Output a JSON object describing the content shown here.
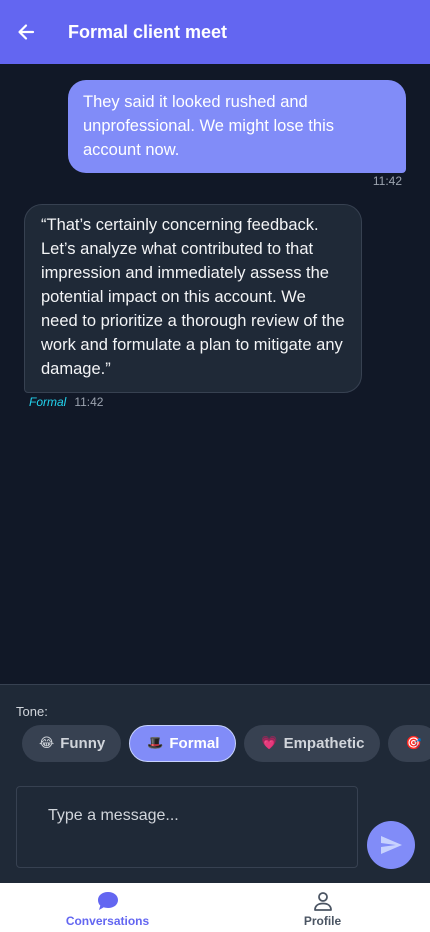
{
  "header": {
    "title": "Formal client meet",
    "back_icon": "arrow-left-icon"
  },
  "messages": {
    "outgoing": {
      "text": "They said it looked rushed and unprofessional. We might lose this account now.",
      "time": "11:42"
    },
    "incoming": {
      "text": "“That’s certainly concerning feedback. Let’s analyze what contributed to that impression and immediately assess the potential impact on this account. We need to prioritize a thorough review of the work and formulate a plan to mitigate any damage.”",
      "tone": "Formal",
      "time": "11:42"
    }
  },
  "composer": {
    "tone_label": "Tone:",
    "tones": [
      {
        "emoji": "😂",
        "label": "Funny",
        "active": false
      },
      {
        "emoji": "🎩",
        "label": "Formal",
        "active": true
      },
      {
        "emoji": "💗",
        "label": "Empathetic",
        "active": false
      },
      {
        "emoji": "🎯",
        "label": "",
        "active": false
      }
    ],
    "input_placeholder": "Type a message...",
    "send_icon": "send-icon"
  },
  "nav": {
    "items": [
      {
        "label": "Conversations",
        "icon": "chat-bubble-icon",
        "active": true
      },
      {
        "label": "Profile",
        "icon": "user-icon",
        "active": false
      }
    ]
  },
  "colors": {
    "accent": "#6366f1",
    "bubble_out": "#818cf8",
    "bubble_in": "#1f2937",
    "background": "#111827",
    "tone_tag": "#22d3ee"
  }
}
